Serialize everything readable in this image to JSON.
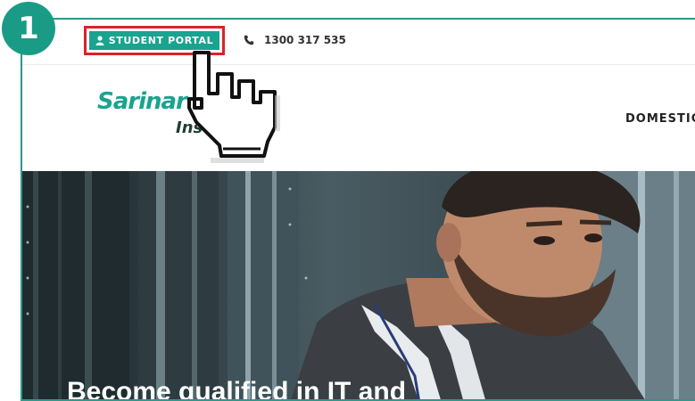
{
  "step": {
    "number": "1"
  },
  "topbar": {
    "portal_label": "STUDENT PORTAL",
    "phone_text": "1300 317 535"
  },
  "header": {
    "logo_line1": "Sarinar",
    "logo_line2": "Insti",
    "nav_item": "DOMESTIC"
  },
  "hero": {
    "title": "Become qualified in IT and"
  },
  "colors": {
    "accent": "#1aa38f",
    "highlight": "#d8232a",
    "frame": "#2a9a8a"
  },
  "icons": [
    "user-icon",
    "phone-icon",
    "hand-pointer-icon"
  ]
}
